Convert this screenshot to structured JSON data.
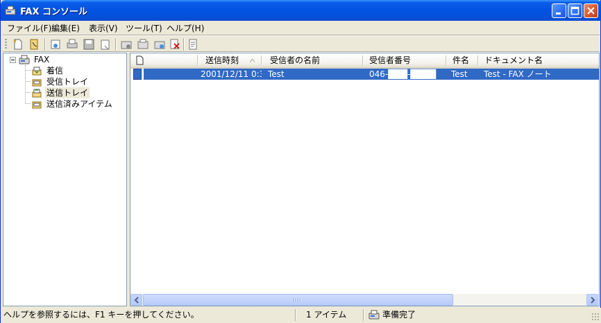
{
  "window": {
    "title": "FAX コンソール",
    "colors": {
      "titlebar": "#0454e3",
      "selection": "#316ac5",
      "face": "#ece9d8"
    }
  },
  "menu": [
    {
      "label": "ファイル(F)"
    },
    {
      "label": "編集(E)"
    },
    {
      "label": "表示(V)"
    },
    {
      "label": "ツール(T)"
    },
    {
      "label": "ヘルプ(H)"
    }
  ],
  "toolbar": {
    "buttons": [
      "new-fax-icon",
      "receive-now-icon",
      "view-icon",
      "print-icon",
      "save-icon",
      "mail-icon",
      "pause-icon",
      "resume-icon",
      "restart-icon",
      "delete-icon",
      "properties-icon"
    ]
  },
  "tree": {
    "root": "FAX",
    "items": [
      {
        "label": "着信",
        "icon": "incoming-icon"
      },
      {
        "label": "受信トレイ",
        "icon": "inbox-icon"
      },
      {
        "label": "送信トレイ",
        "icon": "outbox-icon",
        "selected": true
      },
      {
        "label": "送信済みアイテム",
        "icon": "sent-items-icon"
      }
    ]
  },
  "list": {
    "columns": [
      "送信時刻",
      "受信者の名前",
      "受信者番号",
      "件名",
      "ドキュメント名"
    ],
    "rows": [
      {
        "send_time": "2001/12/11 0:3...",
        "recipient_name": "Test",
        "recipient_number": "046-███-████",
        "subject": "Test",
        "document_name": "Test - FAX ノート"
      }
    ]
  },
  "status": {
    "help": "ヘルプを参照するには、F1 キーを押してください。",
    "count": "1 アイテム",
    "state": "準備完了"
  }
}
